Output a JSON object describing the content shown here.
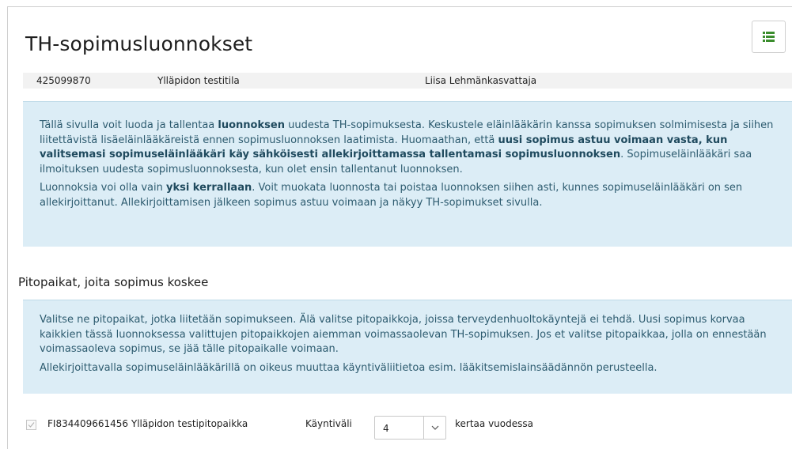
{
  "page": {
    "title": "TH-sopimusluonnokset",
    "menu_icon": "list-icon"
  },
  "info_strip": {
    "id": "425099870",
    "farm": "Ylläpidon testitila",
    "person": "Liisa Lehmänkasvattaja"
  },
  "intro": {
    "p1_a": "Tällä sivulla voit luoda ja tallentaa ",
    "p1_b": "luonnoksen",
    "p1_c": " uudesta TH-sopimuksesta. Keskustele eläinlääkärin kanssa sopimuksen solmimisesta ja siihen liitettävistä lisäeläinlääkäreistä ennen sopimusluonnoksen laatimista. Huomaathan, että ",
    "p1_d": "uusi sopimus astuu voimaan vasta, kun valitsemasi sopimuseläinlääkäri käy sähköisesti allekirjoittamassa tallentamasi sopimusluonnoksen",
    "p1_e": ". Sopimuseläinlääkäri saa ilmoituksen uudesta sopimusluonnoksesta, kun olet ensin tallentanut luonnoksen.",
    "p2_a": "Luonnoksia voi olla vain ",
    "p2_b": "yksi kerrallaan",
    "p2_c": ". Voit muokata luonnosta tai poistaa luonnoksen siihen asti, kunnes sopimuseläinlääkäri on sen allekirjoittanut. Allekirjoittamisen jälkeen sopimus astuu voimaan ja näkyy TH-sopimukset sivulla."
  },
  "section": {
    "title": "Pitopaikat, joita sopimus koskee",
    "p1": "Valitse ne pitopaikat, jotka liitetään sopimukseen. Älä valitse pitopaikkoja, joissa terveydenhuoltokäyntejä ei tehdä. Uusi sopimus korvaa kaikkien tässä luonnoksessa valittujen pitopaikkojen aiemman voimassaolevan TH-sopimuksen. Jos et valitse pitopaikkaa, jolla on ennestään voimassaoleva sopimus, se jää tälle pitopaikalle voimaan.",
    "p2": "Allekirjoittavalla sopimuseläinlääkärillä on oikeus muuttaa käyntiväliitietoa esim. lääkitsemislainsäädännön perusteella."
  },
  "row": {
    "checked": true,
    "place": "FI834409661456 Ylläpidon testipitopaikka",
    "interval_label": "Käyntiväli",
    "interval_value": "4",
    "suffix": "kertaa vuodessa"
  }
}
